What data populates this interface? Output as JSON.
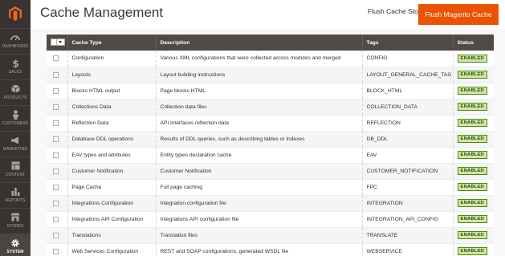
{
  "sidebar": {
    "items": [
      {
        "label": "DASHBOARD",
        "icon": "dashboard-icon"
      },
      {
        "label": "SALES",
        "icon": "dollar-icon"
      },
      {
        "label": "PRODUCTS",
        "icon": "box-icon"
      },
      {
        "label": "CUSTOMERS",
        "icon": "person-icon"
      },
      {
        "label": "MARKETING",
        "icon": "megaphone-icon"
      },
      {
        "label": "CONTENT",
        "icon": "grid-icon"
      },
      {
        "label": "REPORTS",
        "icon": "bar-chart-icon"
      },
      {
        "label": "STORES",
        "icon": "store-icon"
      },
      {
        "label": "SYSTEM",
        "icon": "gear-icon"
      }
    ],
    "active": "SYSTEM"
  },
  "header": {
    "title": "Cache Management",
    "flush_storage_label": "Flush Cache Storage",
    "flush_magento_label": "Flush Magento Cache"
  },
  "grid": {
    "columns": {
      "type": "Cache Type",
      "description": "Description",
      "tags": "Tags",
      "status": "Status"
    },
    "rows": [
      {
        "type": "Configuration",
        "description": "Various XML configurations that were collected across modules and merged",
        "tags": "CONFIG",
        "status": "ENABLED"
      },
      {
        "type": "Layouts",
        "description": "Layout building instructions",
        "tags": "LAYOUT_GENERAL_CACHE_TAG",
        "status": "ENABLED"
      },
      {
        "type": "Blocks HTML output",
        "description": "Page blocks HTML",
        "tags": "BLOCK_HTML",
        "status": "ENABLED"
      },
      {
        "type": "Collections Data",
        "description": "Collection data files",
        "tags": "COLLECTION_DATA",
        "status": "ENABLED"
      },
      {
        "type": "Reflection Data",
        "description": "API interfaces reflection data",
        "tags": "REFLECTION",
        "status": "ENABLED"
      },
      {
        "type": "Database DDL operations",
        "description": "Results of DDL queries, such as describing tables or indexes",
        "tags": "DB_DDL",
        "status": "ENABLED"
      },
      {
        "type": "EAV types and attributes",
        "description": "Entity types declaration cache",
        "tags": "EAV",
        "status": "ENABLED"
      },
      {
        "type": "Customer Notification",
        "description": "Customer Notification",
        "tags": "CUSTOMER_NOTIFICATION",
        "status": "ENABLED"
      },
      {
        "type": "Page Cache",
        "description": "Full page caching",
        "tags": "FPC",
        "status": "ENABLED"
      },
      {
        "type": "Integrations Configuration",
        "description": "Integration configuration file",
        "tags": "INTEGRATION",
        "status": "ENABLED"
      },
      {
        "type": "Integrations API Configuration",
        "description": "Integrations API configuration file",
        "tags": "INTEGRATION_API_CONFIG",
        "status": "ENABLED"
      },
      {
        "type": "Translations",
        "description": "Translation files",
        "tags": "TRANSLATE",
        "status": "ENABLED"
      },
      {
        "type": "Web Services Configuration",
        "description": "REST and SOAP configurations, generated WSDL file",
        "tags": "WEBSERVICE",
        "status": "ENABLED"
      }
    ]
  },
  "colors": {
    "sidebar_bg": "#373330",
    "accent": "#eb5202",
    "grid_header_bg": "#514943",
    "status_bg": "#d0e5a9",
    "status_text": "#185b00"
  }
}
